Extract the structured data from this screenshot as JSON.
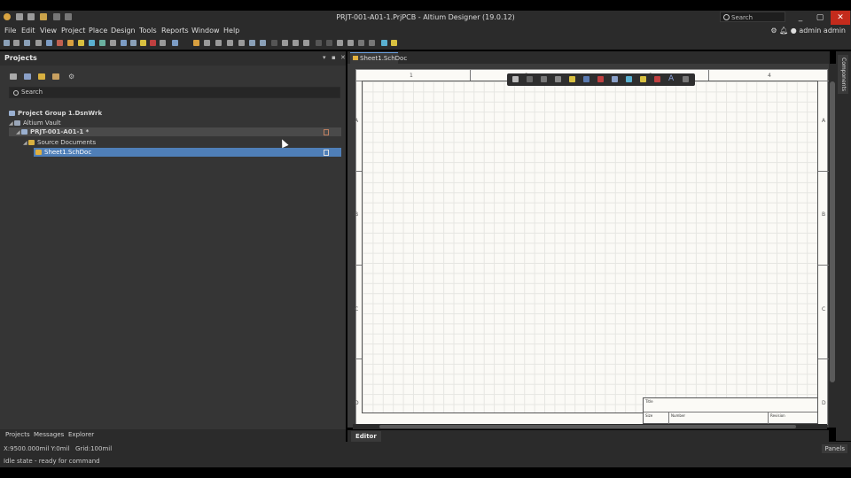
{
  "window": {
    "title": "PRJT-001-A01-1.PrjPCB - Altium Designer (19.0.12)",
    "search_label": "Search",
    "min": "_",
    "max": "▢",
    "close": "✕"
  },
  "menu": {
    "items": [
      "File",
      "Edit",
      "View",
      "Project",
      "Place",
      "Design",
      "Tools",
      "Reports",
      "Window",
      "Help"
    ],
    "user": "admin admin"
  },
  "panel": {
    "title": "Projects",
    "search_placeholder": "Search",
    "tree": {
      "group": "Project Group 1.DsnWrk",
      "vault": "Altium Vault",
      "project": "PRJT-001-A01-1 *",
      "folder": "Source Documents",
      "document": "Sheet1.SchDoc"
    },
    "bottom_tabs": [
      "Projects",
      "Messages",
      "Explorer"
    ]
  },
  "document": {
    "tab_label": "Sheet1.SchDoc",
    "editor_tab": "Editor",
    "zones_top": [
      "1",
      "2",
      "3",
      "4"
    ],
    "zones_side": [
      "A",
      "B",
      "C",
      "D"
    ],
    "title_block": {
      "title": "Title",
      "size": "Size",
      "number": "Number",
      "revision": "Revision"
    }
  },
  "side_panel": {
    "label": "Components"
  },
  "status": {
    "coords": "X:9500.000mil Y:0mil",
    "grid": "Grid:100mil",
    "idle": "Idle state - ready for command",
    "panels_button": "Panels"
  },
  "colors": {
    "chrome": "#2b2b2b",
    "panel": "#353535",
    "selection": "#4f7fb8",
    "sheet": "#fbfaf6",
    "close": "#c42b1c"
  }
}
